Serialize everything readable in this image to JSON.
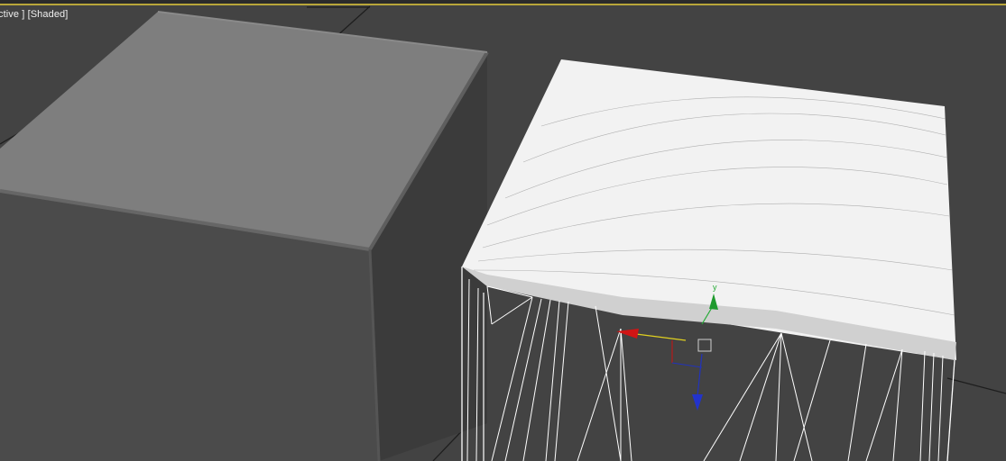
{
  "viewport": {
    "label_view": "ctive ]",
    "label_mode": "[Shaded]",
    "colors": {
      "background": "#434343",
      "grid_line": "#1f1f1f",
      "border_active": "#b9a63a",
      "box_top": "#7d7d7d",
      "box_front": "#4a4a4a",
      "box_side": "#3a3a3a",
      "wireframe": "#ffffff"
    }
  },
  "objects": [
    {
      "name": "shaded-box",
      "mode": "shaded"
    },
    {
      "name": "wireframe-box",
      "mode": "wireframe"
    }
  ],
  "gizmo": {
    "axis_y": "y",
    "x_color": "#cc1111",
    "y_color": "#22aa33",
    "z_color": "#2233bb"
  }
}
